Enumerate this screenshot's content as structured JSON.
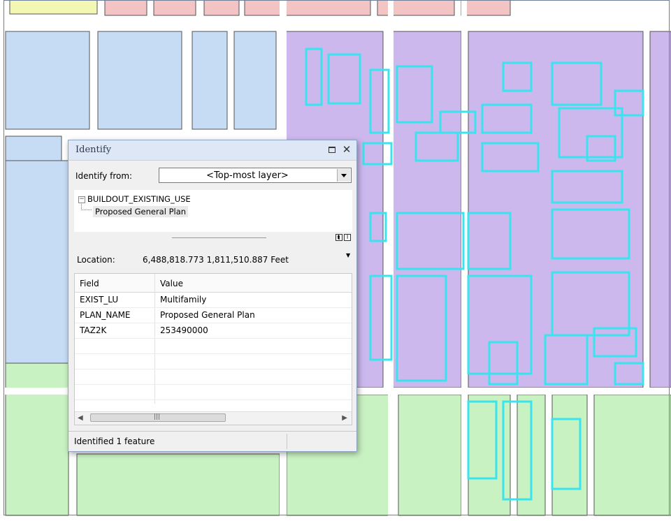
{
  "dialog": {
    "title": "Identify",
    "restore_icon": "restore-window-icon",
    "close_glyph": "✕",
    "identify_from_label": "Identify from:",
    "identify_from_value": "<Top-most layer>",
    "tree": {
      "expander": "−",
      "layer": "BUILDOUT_EXISTING_USE",
      "feature": "Proposed General Plan"
    },
    "location_label": "Location:",
    "location_value": "6,488,818.773  1,811,510.887 Feet",
    "columns": {
      "field": "Field",
      "value": "Value"
    },
    "rows": [
      {
        "field": "EXIST_LU",
        "value": "Multifamily"
      },
      {
        "field": "PLAN_NAME",
        "value": "Proposed General Plan"
      },
      {
        "field": "TAZ2K",
        "value": "253490000"
      }
    ],
    "status": "Identified 1 feature"
  },
  "map": {
    "colors": {
      "residential_lowdensity": "#c6dcf5",
      "commercial": "#f3c4c4",
      "mixed_use": "#cdb8ee",
      "parks_open": "#c9f2c2",
      "industrial_yellow": "#f2f7b3",
      "parcel_outline": "#555555",
      "selection": "#39e4ee"
    }
  }
}
